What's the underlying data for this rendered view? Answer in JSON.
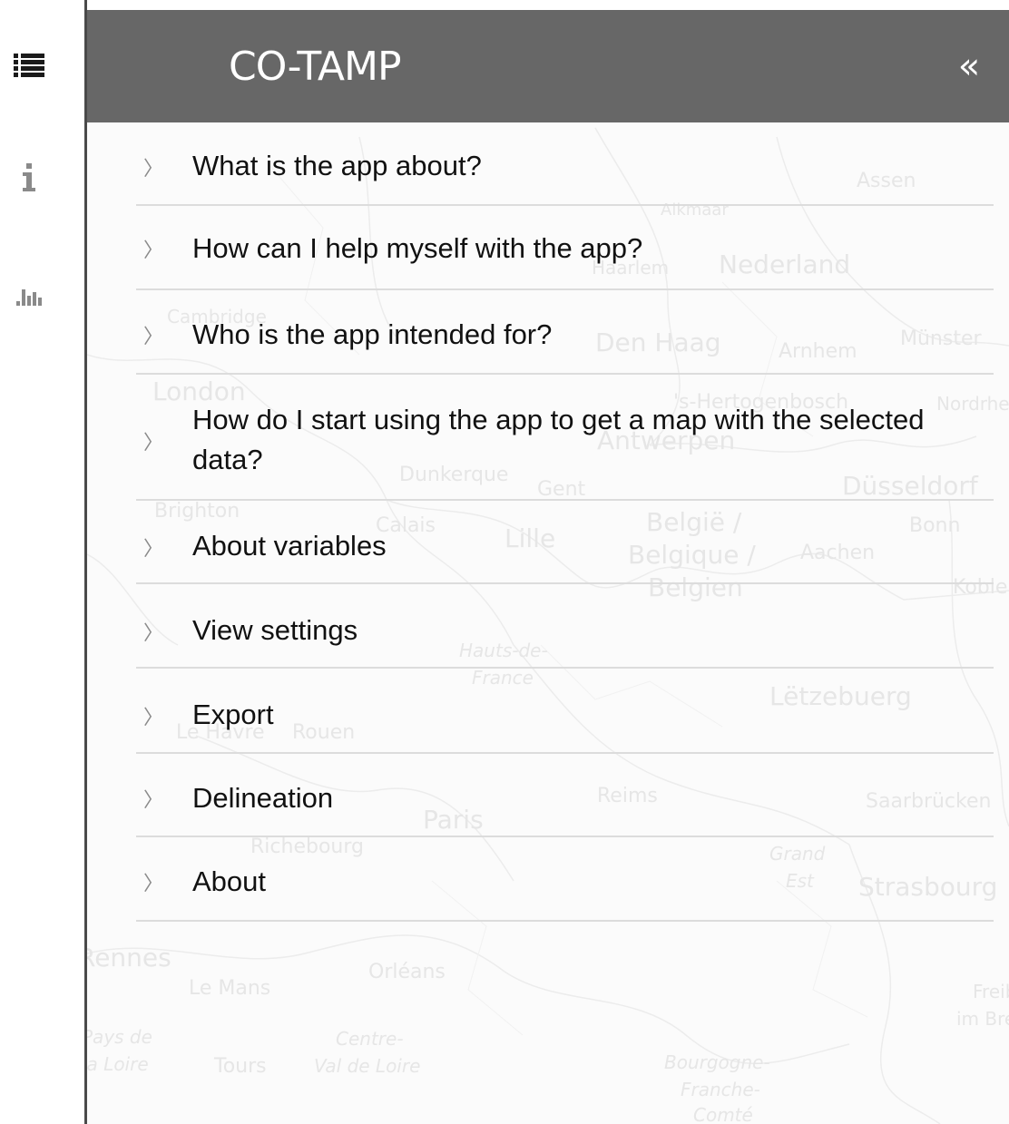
{
  "rail": {
    "items": [
      {
        "name": "list-icon"
      },
      {
        "name": "info-icon"
      },
      {
        "name": "bar-chart-icon"
      }
    ]
  },
  "header": {
    "title": "CO-TAMP",
    "collapse_glyph": "«"
  },
  "faq": {
    "chevron": "〉",
    "items": [
      {
        "label": "What is the app about?"
      },
      {
        "label": "How can I help myself with the app?"
      },
      {
        "label": "Who is the app intended for?"
      },
      {
        "label": "How do I start using the app to get a map with the selected data?"
      },
      {
        "label": "About variables"
      },
      {
        "label": "View settings"
      },
      {
        "label": "Export"
      },
      {
        "label": "Delineation"
      },
      {
        "label": "About"
      }
    ]
  },
  "map": {
    "place_labels": [
      "Assen",
      "Alkmaar",
      "Nederland",
      "Haarlem",
      "Cambridge",
      "Den Haag",
      "Arnhem",
      "Münster",
      "London",
      "'s-Hertogenbosch",
      "Antwerpen",
      "Nordrhein-Westfalen",
      "Dunkerque",
      "Gent",
      "Düsseldorf",
      "Brighton",
      "Calais",
      "Lille",
      "België /",
      "Belgique /",
      "Belgien",
      "Aachen",
      "Bonn",
      "Koblenz",
      "Hauts-de-",
      "France",
      "Lëtzebuerg",
      "Le Havre",
      "Rouen",
      "Reims",
      "Saarbrücken",
      "Paris",
      "Richebourg",
      "Grand",
      "Est",
      "Strasbourg",
      "Rennes",
      "Le Mans",
      "Orléans",
      "Centre-",
      "Val de Loire",
      "Tours",
      "Bourgogne-",
      "Franche-",
      "Comté",
      "Pays de",
      "la Loire",
      "Freiburg",
      "im Breisgau"
    ]
  },
  "colors": {
    "header_bg": "#676767",
    "header_text": "#ffffff",
    "item_text": "#111111",
    "divider": "#dcdcdc",
    "rail_border": "#4a4a4a"
  }
}
